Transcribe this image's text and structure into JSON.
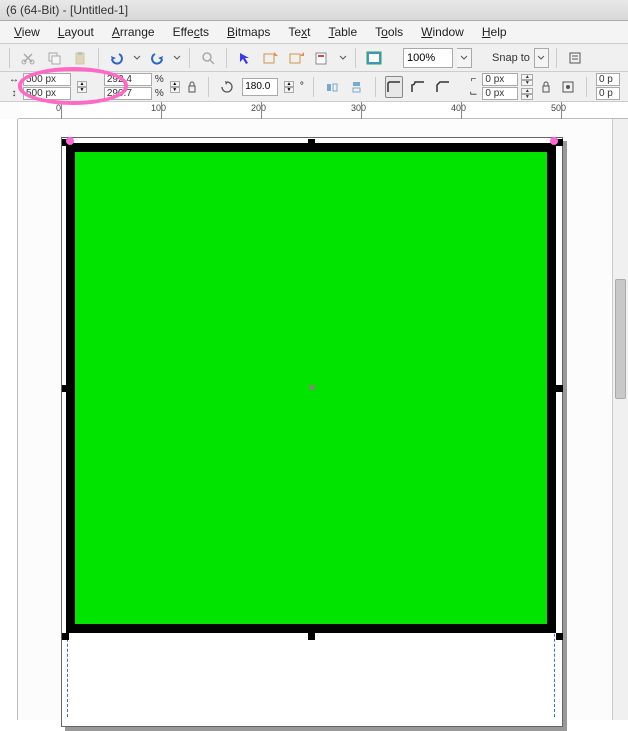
{
  "title": "(6 (64-Bit) - [Untitled-1]",
  "menu": {
    "view": "View",
    "layout": "Layout",
    "arrange": "Arrange",
    "effects": "Effects",
    "bitmaps": "Bitmaps",
    "text": "Text",
    "table": "Table",
    "tools": "Tools",
    "window": "Window",
    "help": "Help"
  },
  "toolbar1": {
    "zoom": "100%",
    "snap_label": "Snap to"
  },
  "propbar": {
    "width": "500 px",
    "height": "500 px",
    "scale_x": "292.4",
    "scale_y": "290.7",
    "scale_unit": "%",
    "rotation": "180.0",
    "outline_w": "0 px",
    "outline_h": "0 px",
    "units_r": "0 p"
  },
  "ruler": {
    "t0": "0",
    "t100": "100",
    "t200": "200",
    "t300": "300",
    "t400": "400",
    "t500": "500"
  },
  "icons": {
    "undo": "undo-icon",
    "redo": "redo-icon",
    "arrow": "arrow-icon",
    "search": "search-icon",
    "align_l": "align-left-icon",
    "align_r": "align-right-icon",
    "group": "group-icon",
    "image": "image-icon",
    "lock": "lock-icon",
    "rot": "rotate-icon",
    "mirror_h": "mirror-h-icon",
    "mirror_v": "mirror-v-icon",
    "corner": "corner-icon",
    "line": "line-icon",
    "wrap": "wrap-icon",
    "grid": "grid-icon"
  }
}
